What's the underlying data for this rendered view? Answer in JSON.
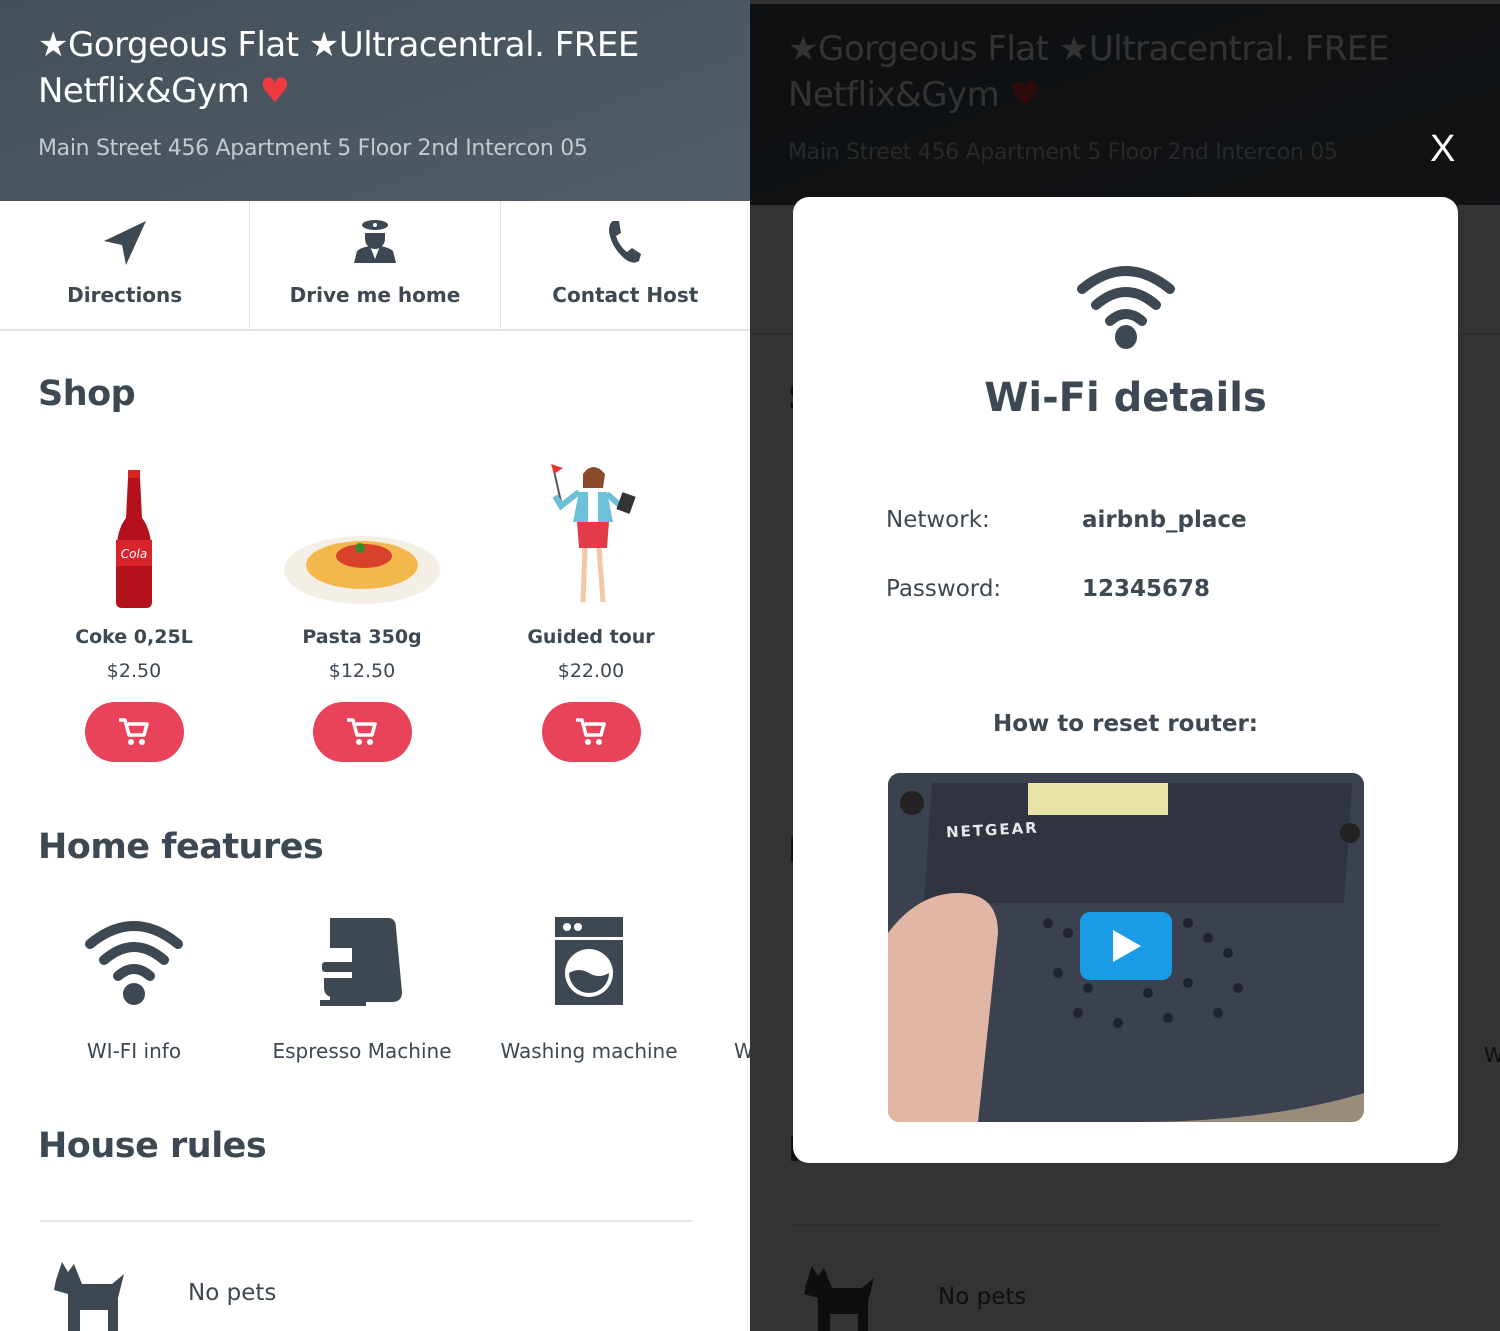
{
  "listing": {
    "title_part1": "Gorgeous Flat",
    "title_part2": "Ultracentral. FREE Netflix&Gym",
    "address": "Main Street 456 Apartment 5 Floor 2nd Intercon 05"
  },
  "actions": [
    {
      "label": "Directions",
      "icon": "navigation-arrow-icon"
    },
    {
      "label": "Drive me home",
      "icon": "chauffeur-icon"
    },
    {
      "label": "Contact Host",
      "icon": "phone-icon"
    }
  ],
  "shop": {
    "heading": "Shop",
    "products": [
      {
        "name": "Coke 0,25L",
        "price": "$2.50",
        "brand_label": "Cola"
      },
      {
        "name": "Pasta 350g",
        "price": "$12.50"
      },
      {
        "name": "Guided tour",
        "price": "$22.00"
      }
    ]
  },
  "features": {
    "heading": "Home features",
    "items": [
      {
        "label": "WI-FI info",
        "icon": "wifi-icon"
      },
      {
        "label": "Espresso Machine",
        "icon": "espresso-machine-icon"
      },
      {
        "label": "Washing machine",
        "icon": "washing-machine-icon"
      },
      {
        "label": "W"
      }
    ]
  },
  "rules": {
    "heading": "House rules",
    "items": [
      {
        "label": "No pets",
        "icon": "dog-icon"
      }
    ]
  },
  "modal": {
    "close_label": "X",
    "title": "Wi-Fi details",
    "network_label": "Network:",
    "network_value": "airbnb_place",
    "password_label": "Password:",
    "password_value": "12345678",
    "reset_heading": "How to reset router:",
    "video_brand": "NETGEAR"
  },
  "colors": {
    "header": "#4a5560",
    "text": "#3d4852",
    "accent": "#e8435a",
    "heart": "#ef3b3f",
    "play": "#1a9be6"
  }
}
